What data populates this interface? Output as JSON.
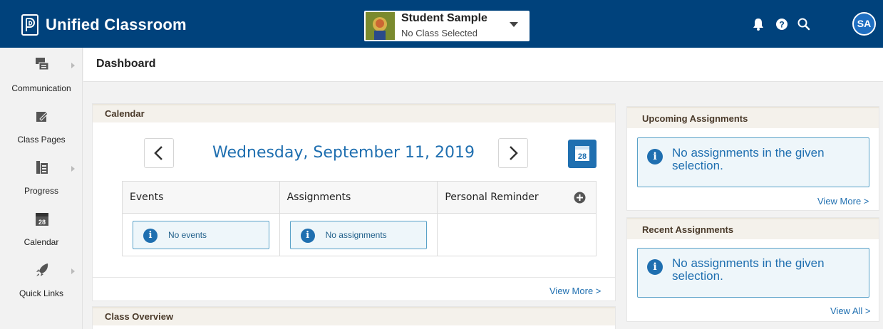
{
  "app": {
    "title": "Unified Classroom"
  },
  "student": {
    "name": "Student Sample",
    "class": "No Class Selected"
  },
  "user": {
    "initials": "SA"
  },
  "sidebar": {
    "items": [
      {
        "label": "Communication",
        "icon": "chat-icon"
      },
      {
        "label": "Class Pages",
        "icon": "edit-page-icon"
      },
      {
        "label": "Progress",
        "icon": "gradebook-icon"
      },
      {
        "label": "Calendar",
        "icon": "calendar-icon"
      },
      {
        "label": "Quick Links",
        "icon": "rocket-icon"
      }
    ]
  },
  "page": {
    "title": "Dashboard"
  },
  "calendar": {
    "title": "Calendar",
    "date": "Wednesday, September 11, 2019",
    "day_badge": "28",
    "columns": [
      "Events",
      "Assignments",
      "Personal Reminder"
    ],
    "events_empty": "No events",
    "assignments_empty": "No assignments",
    "view_more": "View More >"
  },
  "class_overview": {
    "title": "Class Overview"
  },
  "upcoming": {
    "title": "Upcoming Assignments",
    "empty": "No assignments in the given selection.",
    "view_more": "View More >"
  },
  "recent": {
    "title": "Recent Assignments",
    "empty": "No assignments in the given selection.",
    "view_all": "View All >"
  },
  "colors": {
    "topbar": "#00427c",
    "accent": "#1f6fb0",
    "badge": "#1f6fc2"
  }
}
